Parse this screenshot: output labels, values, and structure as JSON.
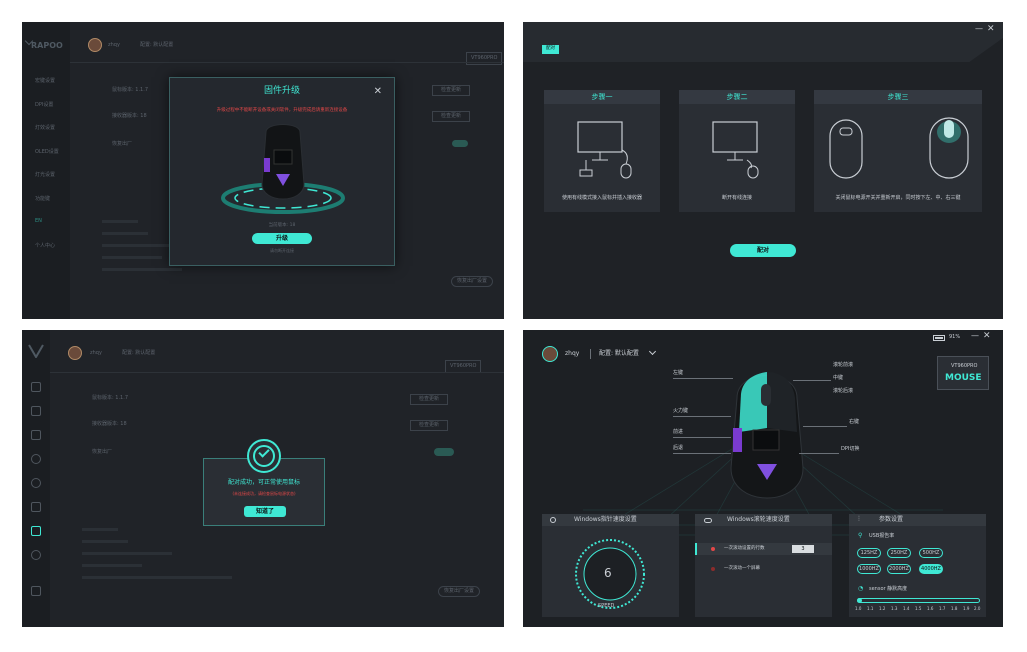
{
  "panel1": {
    "brand": "RAPOO",
    "user": "zhqy",
    "config": "配置: 默认配置",
    "model_badge": "VT960PRO",
    "menu": [
      "宏键设置",
      "DPI设置",
      "灯效设置",
      "OLED设置",
      "灯光设置",
      "功能键",
      "EN",
      "个人中心"
    ],
    "rows": [
      {
        "label": "鼠标版本: 1.1.7",
        "btn": "检查更新"
      },
      {
        "label": "接收器版本: 18",
        "btn": "检查更新"
      },
      {
        "label": "恢复出厂",
        "btn": ""
      }
    ],
    "bottom_button": "恢复出厂设置",
    "dialog": {
      "title": "固件升级",
      "warning": "升级过程中不能断开设备或关闭软件，升级完成后请重新连接设备",
      "progress_text": "当前版本: 18",
      "upgrade_button": "升级",
      "footer_text": "请勿断开连接"
    }
  },
  "panel2": {
    "tab": "配对",
    "steps": [
      {
        "title": "步骤一",
        "text": "使用有线模式接入鼠标并插入接收器"
      },
      {
        "title": "步骤二",
        "text": "断开有线连接"
      },
      {
        "title": "步骤三",
        "text": "关闭鼠标电源开关并重新开启，同时按下左、中、右三键"
      }
    ],
    "pair_button": "配对"
  },
  "panel3": {
    "user": "zhqy",
    "config": "配置: 默认配置",
    "model_badge": "VT960PRO",
    "rows": [
      {
        "label": "鼠标版本: 1.1.7",
        "btn": "检查更新"
      },
      {
        "label": "接收器版本: 18",
        "btn": "检查更新"
      },
      {
        "label": "恢复出厂",
        "btn": ""
      }
    ],
    "bottom_button": "恢复出厂设置",
    "dialog": {
      "message": "配对成功，可正常使用鼠标",
      "sub": "(未连接成功，请检查鼠标电源状态)",
      "ok_button": "知道了"
    }
  },
  "panel4": {
    "battery": "91%",
    "user": "zhqy",
    "config": "配置: 默认配置",
    "model": "VT960PRO",
    "model_sub": "MOUSE",
    "callouts_left": [
      "左键",
      "火力键",
      "前进",
      "后退"
    ],
    "callouts_right": [
      "滚轮前滚",
      "中键",
      "滚轮后滚",
      "右键",
      "DPI切换"
    ],
    "pointer": {
      "title": "Windows指针速度设置",
      "value": "6",
      "unit": "SPEED"
    },
    "wheel": {
      "title": "Windows滚轮速度设置",
      "opt1": "一次滚动设置的行数",
      "opt1_value": "3",
      "opt2": "一次滚动一个屏幕"
    },
    "params": {
      "title": "参数设置",
      "usb_label": "USB报告率",
      "rates": [
        "125HZ",
        "250HZ",
        "500HZ",
        "1000HZ",
        "2000HZ",
        "4000HZ"
      ],
      "rate_selected": "4000HZ",
      "sensor_label": "sensor 静默高度",
      "ticks": [
        "1.0",
        "1.1",
        "1.2",
        "1.3",
        "1.4",
        "1.5",
        "1.6",
        "1.7",
        "1.8",
        "1.9",
        "2.0"
      ]
    }
  },
  "colors": {
    "accent": "#3fe8d4",
    "panel": "#202328",
    "warning": "#e34848"
  }
}
